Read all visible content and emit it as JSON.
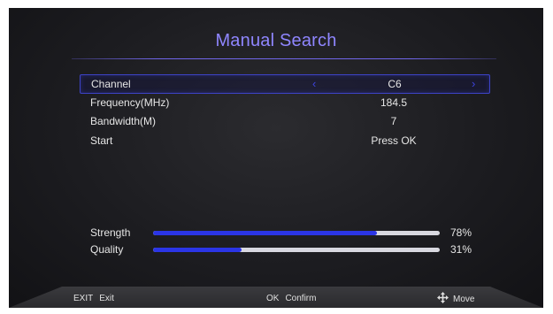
{
  "menu": {
    "title": "Manual Search",
    "rows": [
      {
        "label": "Channel",
        "value": "C6"
      },
      {
        "label": "Frequency(MHz)",
        "value": "184.5"
      },
      {
        "label": "Bandwidth(M)",
        "value": "7"
      },
      {
        "label": "Start",
        "value": "Press OK"
      }
    ],
    "arrows": {
      "left": "‹",
      "right": "›"
    }
  },
  "signal": {
    "strength": {
      "label": "Strength",
      "percent_text": "78%",
      "percent": 78
    },
    "quality": {
      "label": "Quality",
      "percent_text": "31%",
      "percent": 31
    }
  },
  "footer": {
    "exit": {
      "key": "EXIT",
      "label": "Exit"
    },
    "ok": {
      "key": "OK",
      "label": "Confirm"
    },
    "move": {
      "label": "Move",
      "icon": "move-icon"
    }
  },
  "colors": {
    "title": "#8f86ff",
    "accent": "#2b35e6",
    "selection_border": "#3d43c8"
  }
}
